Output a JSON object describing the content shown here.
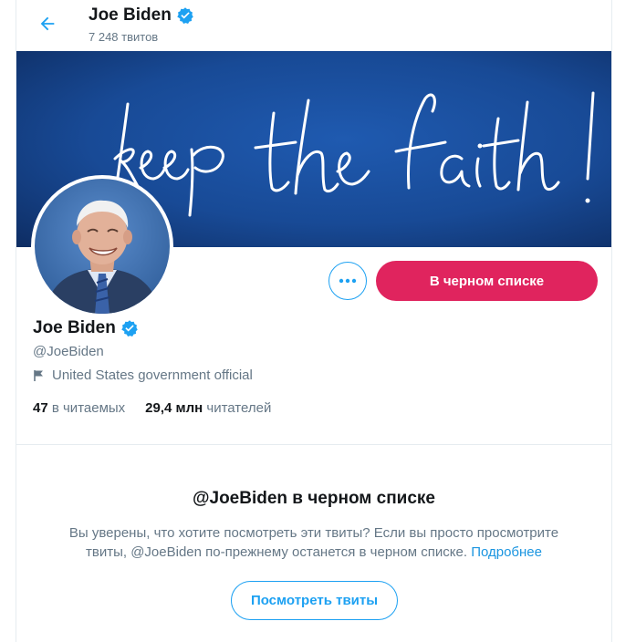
{
  "header": {
    "name": "Joe Biden",
    "tweet_count": "7 248 твитов"
  },
  "banner": {
    "text": "keep the faith!"
  },
  "actions": {
    "more_label": "•••",
    "blocked_label": "В черном списке"
  },
  "profile": {
    "name": "Joe Biden",
    "handle": "@JoeBiden",
    "bio": "United States government official",
    "following_count": "47",
    "following_label": "в читаемых",
    "followers_count": "29,4 млн",
    "followers_label": "читателей"
  },
  "notice": {
    "title": "@JoeBiden в черном списке",
    "text": "Вы уверены, что хотите посмотреть эти твиты? Если вы просто просмотрите твиты, @JoeBiden по-прежнему останется в черном списке.",
    "link": "Подробнее",
    "button_label": "Посмотреть твиты"
  },
  "colors": {
    "accent": "#1da1f2",
    "blocked": "#e0245e",
    "secondary_text": "#657786"
  },
  "icons": {
    "back": "arrow-left-icon",
    "verified": "verified-badge-icon",
    "more": "more-horizontal-icon",
    "bio": "flag-icon"
  }
}
